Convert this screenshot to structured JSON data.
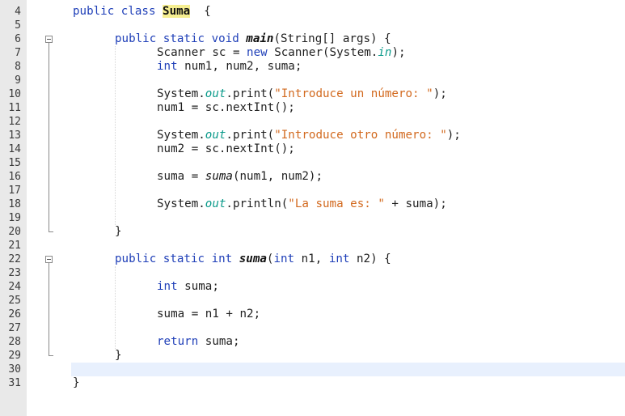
{
  "editor": {
    "highlighted_line": "30",
    "lines": [
      {
        "n": "4",
        "indent": 0,
        "tokens": [
          [
            "kw",
            "public class "
          ],
          [
            "classhl",
            "Suma"
          ],
          [
            "",
            "  {"
          ]
        ]
      },
      {
        "n": "5",
        "indent": 0,
        "tokens": []
      },
      {
        "n": "6",
        "indent": 1,
        "tokens": [
          [
            "kw",
            "public static void "
          ],
          [
            "mth",
            "main"
          ],
          [
            "",
            "(String[] args) {"
          ]
        ]
      },
      {
        "n": "7",
        "indent": 2,
        "tokens": [
          [
            "",
            "Scanner sc = "
          ],
          [
            "kw",
            "new "
          ],
          [
            "",
            "Scanner(System."
          ],
          [
            "fld",
            "in"
          ],
          [
            "",
            ");"
          ]
        ]
      },
      {
        "n": "8",
        "indent": 2,
        "tokens": [
          [
            "kw",
            "int "
          ],
          [
            "",
            "num1, num2, suma;"
          ]
        ]
      },
      {
        "n": "9",
        "indent": 0,
        "tokens": []
      },
      {
        "n": "10",
        "indent": 2,
        "tokens": [
          [
            "",
            "System."
          ],
          [
            "fld",
            "out"
          ],
          [
            "",
            ".print("
          ],
          [
            "str",
            "\"Introduce un número: \""
          ],
          [
            "",
            ");"
          ]
        ]
      },
      {
        "n": "11",
        "indent": 2,
        "tokens": [
          [
            "",
            "num1 = sc.nextInt();"
          ]
        ]
      },
      {
        "n": "12",
        "indent": 0,
        "tokens": []
      },
      {
        "n": "13",
        "indent": 2,
        "tokens": [
          [
            "",
            "System."
          ],
          [
            "fld",
            "out"
          ],
          [
            "",
            ".print("
          ],
          [
            "str",
            "\"Introduce otro número: \""
          ],
          [
            "",
            ");"
          ]
        ]
      },
      {
        "n": "14",
        "indent": 2,
        "tokens": [
          [
            "",
            "num2 = sc.nextInt();"
          ]
        ]
      },
      {
        "n": "15",
        "indent": 0,
        "tokens": []
      },
      {
        "n": "16",
        "indent": 2,
        "tokens": [
          [
            "",
            "suma = "
          ],
          [
            "smeth",
            "suma"
          ],
          [
            "",
            "(num1, num2);"
          ]
        ]
      },
      {
        "n": "17",
        "indent": 0,
        "tokens": []
      },
      {
        "n": "18",
        "indent": 2,
        "tokens": [
          [
            "",
            "System."
          ],
          [
            "fld",
            "out"
          ],
          [
            "",
            ".println("
          ],
          [
            "str",
            "\"La suma es: \""
          ],
          [
            "",
            " + suma);"
          ]
        ]
      },
      {
        "n": "19",
        "indent": 0,
        "tokens": []
      },
      {
        "n": "20",
        "indent": 1,
        "tokens": [
          [
            "",
            "}"
          ]
        ]
      },
      {
        "n": "21",
        "indent": 0,
        "tokens": []
      },
      {
        "n": "22",
        "indent": 1,
        "tokens": [
          [
            "kw",
            "public static int "
          ],
          [
            "mth",
            "suma"
          ],
          [
            "",
            "("
          ],
          [
            "kw",
            "int "
          ],
          [
            "",
            "n1, "
          ],
          [
            "kw",
            "int "
          ],
          [
            "",
            "n2) {"
          ]
        ]
      },
      {
        "n": "23",
        "indent": 0,
        "tokens": []
      },
      {
        "n": "24",
        "indent": 2,
        "tokens": [
          [
            "kw",
            "int "
          ],
          [
            "",
            "suma;"
          ]
        ]
      },
      {
        "n": "25",
        "indent": 0,
        "tokens": []
      },
      {
        "n": "26",
        "indent": 2,
        "tokens": [
          [
            "",
            "suma = n1 + n2;"
          ]
        ]
      },
      {
        "n": "27",
        "indent": 0,
        "tokens": []
      },
      {
        "n": "28",
        "indent": 2,
        "tokens": [
          [
            "kw",
            "return "
          ],
          [
            "",
            "suma;"
          ]
        ]
      },
      {
        "n": "29",
        "indent": 1,
        "tokens": [
          [
            "",
            "}"
          ]
        ]
      },
      {
        "n": "30",
        "indent": 0,
        "tokens": []
      },
      {
        "n": "31",
        "indent": 0,
        "tokens": [
          [
            "",
            "}"
          ]
        ]
      }
    ],
    "folds": [
      {
        "start": "6",
        "end": "20",
        "icon": "fold-collapse-icon"
      },
      {
        "start": "22",
        "end": "29",
        "icon": "fold-collapse-icon"
      }
    ],
    "colors": {
      "keyword": "#1f3fb8",
      "string": "#d2691e",
      "static_field": "#0a9a8a",
      "class_highlight": "#f6ef91",
      "current_line": "#e8f0fd",
      "gutter": "#e9e9e9"
    }
  }
}
